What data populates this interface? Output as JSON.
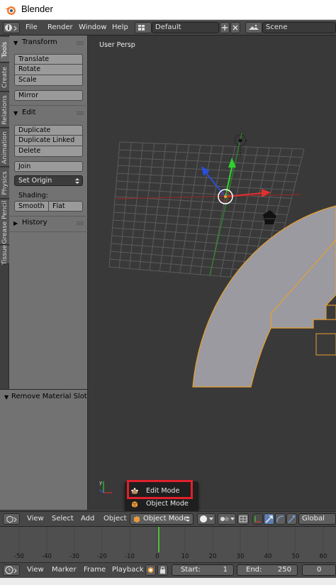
{
  "window": {
    "title": "Blender",
    "icon": "blender-logo-icon"
  },
  "info_header": {
    "menus": [
      "File",
      "Render",
      "Window",
      "Help"
    ],
    "screen_layout": "Default",
    "scene": "Scene"
  },
  "tool_tabs": [
    "Tools",
    "Create",
    "Relations",
    "Animation",
    "Physics",
    "Grease Pencil",
    "Tissue"
  ],
  "tool_shelf": {
    "transform": {
      "title": "Transform",
      "buttons": [
        "Translate",
        "Rotate",
        "Scale"
      ],
      "mirror": "Mirror"
    },
    "edit": {
      "title": "Edit",
      "buttons": [
        "Duplicate",
        "Duplicate Linked",
        "Delete"
      ],
      "join": "Join",
      "set_origin": "Set Origin"
    },
    "shading": {
      "label": "Shading:",
      "smooth": "Smooth",
      "flat": "Flat"
    },
    "history": {
      "title": "History"
    }
  },
  "operator_panel": {
    "title": "Remove Material Slot"
  },
  "viewport": {
    "label": "User Persp"
  },
  "mode_menu": {
    "items": [
      {
        "label": "Edit Mode",
        "icon": "edit-mode-icon"
      },
      {
        "label": "Object Mode",
        "icon": "object-mode-icon"
      }
    ]
  },
  "view3d_header": {
    "menus": [
      "View",
      "Select",
      "Add",
      "Object"
    ],
    "mode": "Object Mode",
    "orientation": "Global"
  },
  "timeline": {
    "ticks": [
      "-50",
      "-40",
      "-30",
      "-20",
      "-10",
      "0",
      "10",
      "20",
      "30",
      "40",
      "50",
      "60"
    ]
  },
  "timeline_header": {
    "menus": [
      "View",
      "Marker",
      "Frame",
      "Playback"
    ],
    "start_label": "Start:",
    "start_value": "1",
    "end_label": "End:",
    "end_value": "250",
    "current_frame": "0"
  },
  "colors": {
    "highlight": "#e0212b",
    "selection_outline": "#e8a030",
    "current_frame": "#4fc035"
  }
}
